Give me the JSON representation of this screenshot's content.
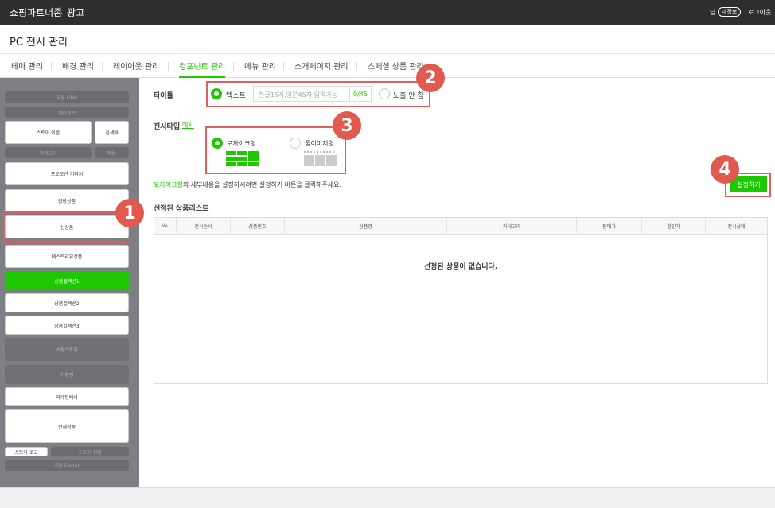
{
  "topbar": {
    "brand": "쇼핑파트너존",
    "section": "광고",
    "user": "님",
    "myinfo": "내정보",
    "logout": "로그아웃"
  },
  "page_title": "PC 전시 관리",
  "tabs": [
    {
      "label": "테마 관리"
    },
    {
      "label": "배경 관리"
    },
    {
      "label": "레이아웃 관리"
    },
    {
      "label": "컴포넌트 관리",
      "active": true
    },
    {
      "label": "메뉴 관리"
    },
    {
      "label": "소개페이지 관리"
    },
    {
      "label": "스페셜 상품 관리"
    }
  ],
  "sidebar": {
    "gnb": "공통 GNB",
    "seller": "셀러정보",
    "store_name": "스토어 이름",
    "search_bar": "검색바",
    "category": "카테고리",
    "menu": "메뉴",
    "promo_image": "프로모션 이미지",
    "featured": "장장상품",
    "new": "신상품",
    "best": "베스트리뷰상품",
    "collection1": "상품컬렉션1",
    "collection2": "상품컬렉션2",
    "collection3": "상품컬렉션3",
    "shopping_story": "쇼핑스토리",
    "exhibition": "기획전",
    "marketing_banner": "마케팅배너",
    "all_products": "전체상품",
    "store_logo": "스토어 로고",
    "store_intro": "스토어 현황",
    "footer": "공통 Footer"
  },
  "form": {
    "title_label": "타이틀",
    "title_option_text": "텍스트",
    "title_placeholder": "한글15자,영문45자 입력가능",
    "title_counter": "0/45",
    "title_option_hide": "노출 안 함",
    "display_type_label": "전시타입",
    "display_type_example": "예시",
    "type_mosaic": "모자이크형",
    "type_full_image": "풀이미지형",
    "hint_highlight": "모자이크형",
    "hint_rest": "의 세부내용을 설정하시려면 설정하기 버튼을 클릭해주세요.",
    "settings_button": "설정하기"
  },
  "list": {
    "heading": "선정된 상품리스트",
    "columns": [
      "No.",
      "전시순서",
      "상품번호",
      "상품명",
      "카테고리",
      "판매가",
      "할인가",
      "전시상태"
    ],
    "empty_message": "선정된 상품이 없습니다."
  },
  "badges": [
    "1",
    "2",
    "3",
    "4"
  ],
  "colors": {
    "accent": "#1ec800",
    "annotation": "#e25a4e",
    "topbar": "#2c2e30",
    "sidebar": "#7d7f84"
  }
}
